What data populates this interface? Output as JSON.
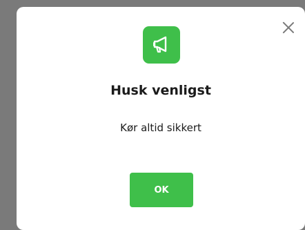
{
  "dialog": {
    "title": "Husk venligst",
    "message": "Kør altid sikkert",
    "ok_label": "OK",
    "close_icon": "close-icon",
    "header_icon": "megaphone-icon"
  },
  "colors": {
    "accent": "#3fbf4a",
    "backdrop": "#7a7a7a",
    "dialog_background": "#ffffff",
    "text": "#1b1b1b"
  }
}
